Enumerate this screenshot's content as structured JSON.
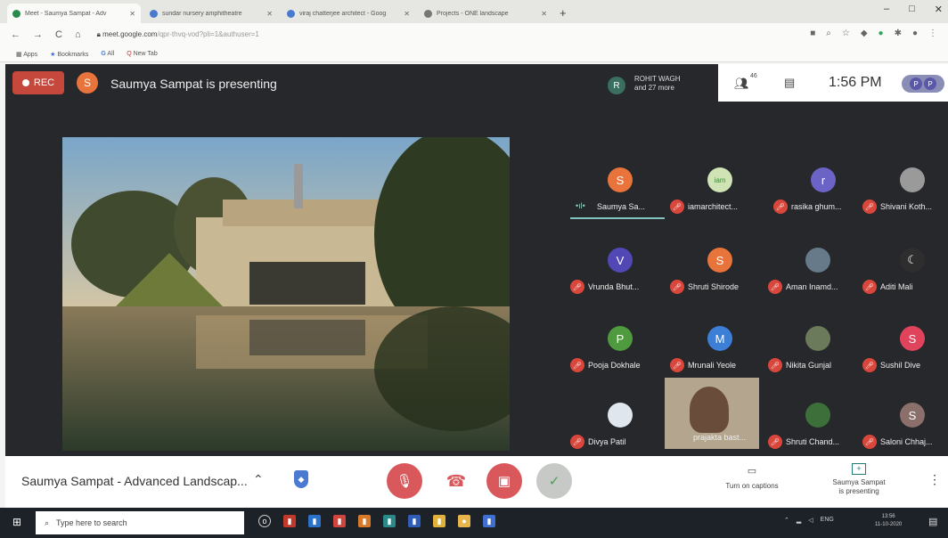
{
  "browser": {
    "tabs": [
      {
        "title": "Meet - Saumya Sampat - Adv",
        "active": true
      },
      {
        "title": "sundar nursery amphitheatre"
      },
      {
        "title": "viraj chatterjee architect - Goog"
      },
      {
        "title": "Projects - ONE landscape"
      }
    ],
    "new_tab": "+",
    "address": "meet.google.com",
    "address_rest": "/qpr-thvq-vod?pli=1&authuser=1",
    "bookmarks": [
      "Apps",
      "Bookmarks",
      "All",
      "New Tab"
    ],
    "window_controls": [
      "–",
      "□",
      "✕"
    ]
  },
  "meet": {
    "rec_label": "REC",
    "presenter_initial": "S",
    "presenting_text": "Saumya Sampat is presenting",
    "participants_initial": "R",
    "participants_name": "ROHIT WAGH",
    "participants_more": "and 27 more",
    "people_count": "46",
    "time": "1:56 PM",
    "avatar_initials": [
      "P",
      "P"
    ],
    "participants": [
      {
        "initial": "S",
        "name": "Saumya Sa...",
        "color": "#e8743b",
        "speaking": true
      },
      {
        "initial": "",
        "name": "iamarchitect...",
        "color": "#cfe3b5"
      },
      {
        "initial": "r",
        "name": "rasika ghum...",
        "color": "#6c63c6"
      },
      {
        "initial": "",
        "name": "Shivani Koth...",
        "color": "#9a9a9a"
      },
      {
        "initial": "V",
        "name": "Vrunda Bhut...",
        "color": "#5248b5"
      },
      {
        "initial": "S",
        "name": "Shruti Shirode",
        "color": "#e8743b"
      },
      {
        "initial": "",
        "name": "Aman Inamd...",
        "color": "#667a8a"
      },
      {
        "initial": "",
        "name": "Aditi Mali",
        "color": "#2e2e2e"
      },
      {
        "initial": "P",
        "name": "Pooja Dokhale",
        "color": "#4f9a3e"
      },
      {
        "initial": "M",
        "name": "Mrunali Yeole",
        "color": "#3d7fd6"
      },
      {
        "initial": "",
        "name": "Nikita Gunjal",
        "color": "#6a7a5a"
      },
      {
        "initial": "S",
        "name": "Sushil Dive",
        "color": "#e0445d"
      },
      {
        "initial": "",
        "name": "Divya Patil",
        "color": "#dfe6ee"
      },
      {
        "initial": "",
        "name": "Shruti Chand...",
        "color": "#3d6f3a"
      },
      {
        "initial": "S",
        "name": "Saloni Chhaj...",
        "color": "#8a6f6a"
      }
    ],
    "video_participant": "prajakta bast...",
    "meeting_title": "Saumya Sampat - Advanced Landscap...",
    "captions_label": "Turn on captions",
    "presenting_btn_line1": "Saumya Sampat",
    "presenting_btn_line2": "is presenting"
  },
  "taskbar": {
    "search_placeholder": "Type here to search",
    "tray": "ENG",
    "time": "13:56",
    "date": "11-10-2020"
  }
}
